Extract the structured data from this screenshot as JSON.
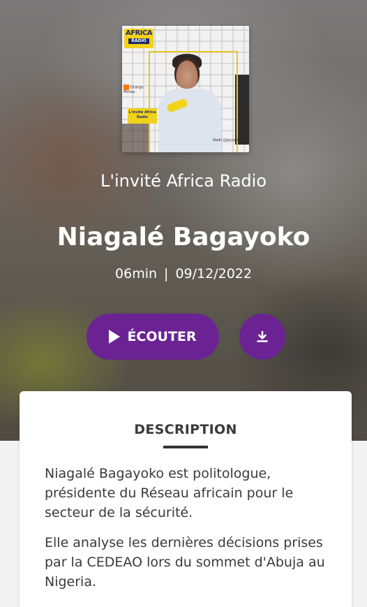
{
  "cover": {
    "logo_line1": "AFRICA",
    "logo_line2": "RADIO",
    "sponsor": "Orange Money",
    "tag": "L'invité Africa Radio",
    "credit": "Nadir Djennad"
  },
  "episode": {
    "show_name": "L'invité Africa Radio",
    "title": "Niagalé Bagayoko",
    "duration": "06min",
    "separator": "|",
    "date": "09/12/2022"
  },
  "actions": {
    "listen_label": "ÉCOUTER",
    "download_icon": "download-icon",
    "accent_color": "#6b2394"
  },
  "description": {
    "heading": "DESCRIPTION",
    "paragraphs": [
      "Niagalé Bagayoko est  politologue, présidente du Réseau africain pour le secteur de la sécurité.",
      "Elle analyse les dernières décisions prises par la CEDEAO lors du sommet d'Abuja au Nigeria."
    ]
  }
}
